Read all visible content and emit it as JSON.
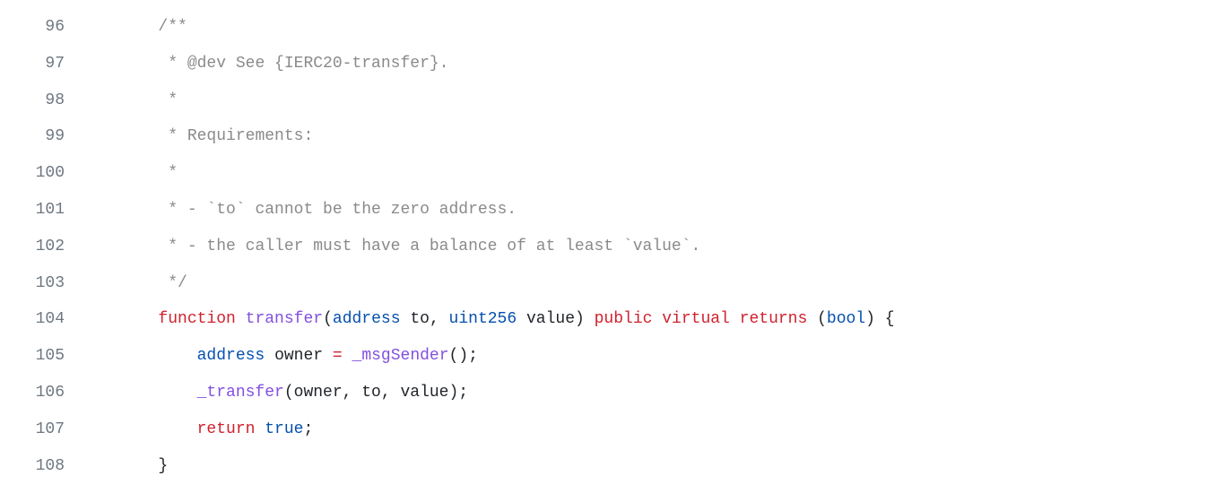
{
  "lines": [
    {
      "num": "96",
      "indent": "        ",
      "tokens": [
        {
          "cls": "tok-comment",
          "t": "/**"
        }
      ]
    },
    {
      "num": "97",
      "indent": "        ",
      "tokens": [
        {
          "cls": "tok-comment",
          "t": " * @dev See {IERC20-transfer}."
        }
      ]
    },
    {
      "num": "98",
      "indent": "        ",
      "tokens": [
        {
          "cls": "tok-comment",
          "t": " *"
        }
      ]
    },
    {
      "num": "99",
      "indent": "        ",
      "tokens": [
        {
          "cls": "tok-comment",
          "t": " * Requirements:"
        }
      ]
    },
    {
      "num": "100",
      "indent": "        ",
      "tokens": [
        {
          "cls": "tok-comment",
          "t": " *"
        }
      ]
    },
    {
      "num": "101",
      "indent": "        ",
      "tokens": [
        {
          "cls": "tok-comment",
          "t": " * - `to` cannot be the zero address."
        }
      ]
    },
    {
      "num": "102",
      "indent": "        ",
      "tokens": [
        {
          "cls": "tok-comment",
          "t": " * - the caller must have a balance of at least `value`."
        }
      ]
    },
    {
      "num": "103",
      "indent": "        ",
      "tokens": [
        {
          "cls": "tok-comment",
          "t": " */"
        }
      ]
    },
    {
      "num": "104",
      "indent": "        ",
      "tokens": [
        {
          "cls": "tok-keyword",
          "t": "function"
        },
        {
          "cls": "",
          "t": " "
        },
        {
          "cls": "tok-func",
          "t": "transfer"
        },
        {
          "cls": "",
          "t": "("
        },
        {
          "cls": "tok-type",
          "t": "address"
        },
        {
          "cls": "",
          "t": " "
        },
        {
          "cls": "tok-ident",
          "t": "to"
        },
        {
          "cls": "",
          "t": ", "
        },
        {
          "cls": "tok-type",
          "t": "uint256"
        },
        {
          "cls": "",
          "t": " "
        },
        {
          "cls": "tok-ident",
          "t": "value"
        },
        {
          "cls": "",
          "t": ") "
        },
        {
          "cls": "tok-keyword",
          "t": "public"
        },
        {
          "cls": "",
          "t": " "
        },
        {
          "cls": "tok-keyword",
          "t": "virtual"
        },
        {
          "cls": "",
          "t": " "
        },
        {
          "cls": "tok-keyword",
          "t": "returns"
        },
        {
          "cls": "",
          "t": " ("
        },
        {
          "cls": "tok-type",
          "t": "bool"
        },
        {
          "cls": "",
          "t": ") {"
        }
      ]
    },
    {
      "num": "105",
      "indent": "            ",
      "tokens": [
        {
          "cls": "tok-type",
          "t": "address"
        },
        {
          "cls": "",
          "t": " "
        },
        {
          "cls": "tok-ident",
          "t": "owner"
        },
        {
          "cls": "",
          "t": " "
        },
        {
          "cls": "tok-keyword",
          "t": "="
        },
        {
          "cls": "",
          "t": " "
        },
        {
          "cls": "tok-func",
          "t": "_msgSender"
        },
        {
          "cls": "",
          "t": "();"
        }
      ]
    },
    {
      "num": "106",
      "indent": "            ",
      "tokens": [
        {
          "cls": "tok-func",
          "t": "_transfer"
        },
        {
          "cls": "",
          "t": "(owner, to, value);"
        }
      ]
    },
    {
      "num": "107",
      "indent": "            ",
      "tokens": [
        {
          "cls": "tok-keyword",
          "t": "return"
        },
        {
          "cls": "",
          "t": " "
        },
        {
          "cls": "tok-const",
          "t": "true"
        },
        {
          "cls": "",
          "t": ";"
        }
      ]
    },
    {
      "num": "108",
      "indent": "        ",
      "tokens": [
        {
          "cls": "",
          "t": "}"
        }
      ]
    }
  ]
}
